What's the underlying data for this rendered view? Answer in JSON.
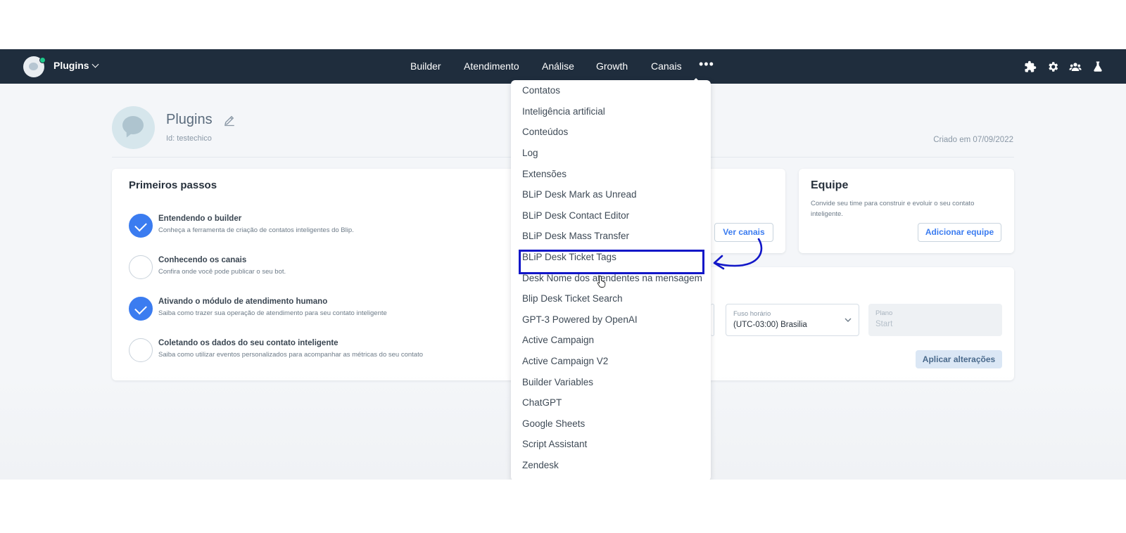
{
  "topbar": {
    "bot_name": "Plugins",
    "nav": [
      "Builder",
      "Atendimento",
      "Análise",
      "Growth",
      "Canais"
    ],
    "more": "•••",
    "icons": [
      "puzzle-icon",
      "gear-icon",
      "team-icon",
      "flask-icon"
    ]
  },
  "header": {
    "title": "Plugins",
    "id_label": "Id: testechico",
    "created_label": "Criado em 07/09/2022"
  },
  "steps_card": {
    "title": "Primeiros passos",
    "steps": [
      {
        "title": "Entendendo o builder",
        "desc": "Conheça a ferramenta de criação de contatos inteligentes do Blip.",
        "done": true
      },
      {
        "title": "Conhecendo os canais",
        "desc": "Confira onde você pode publicar o seu bot.",
        "done": false
      },
      {
        "title": "Ativando o módulo de atendimento humano",
        "desc": "Saiba como trazer sua operação de atendimento para seu contato inteligente",
        "done": true
      },
      {
        "title": "Coletando os dados do seu contato inteligente",
        "desc": "Saiba como utilizar eventos personalizados para acompanhar as métricas do seu contato",
        "done": false
      }
    ]
  },
  "channels_card": {
    "button": "Ver canais"
  },
  "team_card": {
    "title": "Equipe",
    "desc": "Convide seu time para construir e evoluir o seu contato inteligente.",
    "button": "Adicionar equipe"
  },
  "settings_card": {
    "timezone_label": "Fuso horário",
    "timezone_value": "(UTC-03:00) Brasilia",
    "plan_label": "Plano",
    "plan_value": "Start",
    "apply_button": "Aplicar alterações"
  },
  "dropdown": {
    "items": [
      "Contatos",
      "Inteligência artificial",
      "Conteúdos",
      "Log",
      "Extensões",
      "BLiP Desk Mark as Unread",
      "BLiP Desk Contact Editor",
      "BLiP Desk Mass Transfer",
      "BLiP Desk Ticket Tags",
      "Desk Nome dos atendentes na mensagem",
      "Blip Desk Ticket Search",
      "GPT-3 Powered by OpenAI",
      "Active Campaign",
      "Active Campaign V2",
      "Builder Variables",
      "ChatGPT",
      "Google Sheets",
      "Script Assistant",
      "Zendesk"
    ],
    "highlighted_index": 8
  },
  "colors": {
    "topbar": "#1f2d3d",
    "primary": "#3b7cf0",
    "highlight": "#1217c8",
    "status_online": "#1ec98b"
  }
}
